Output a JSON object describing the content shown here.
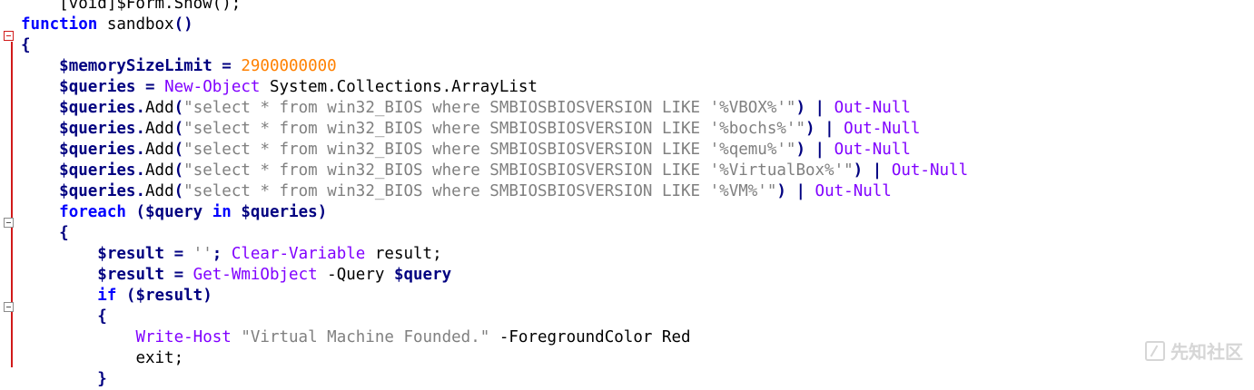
{
  "editor": {
    "lines": [
      [
        {
          "t": "    [void]$Form.Show();",
          "c": "txt"
        }
      ],
      [
        {
          "t": "function",
          "c": "kw"
        },
        {
          "t": " sandbox",
          "c": "txt"
        },
        {
          "t": "()",
          "c": "op"
        }
      ],
      [
        {
          "t": "{",
          "c": "op"
        }
      ],
      [
        {
          "t": "    ",
          "c": "txt"
        },
        {
          "t": "$memorySizeLimit",
          "c": "var"
        },
        {
          "t": " = ",
          "c": "op"
        },
        {
          "t": "2900000000",
          "c": "num"
        }
      ],
      [
        {
          "t": "    ",
          "c": "txt"
        },
        {
          "t": "$queries",
          "c": "var"
        },
        {
          "t": " = ",
          "c": "op"
        },
        {
          "t": "New-Object",
          "c": "cmd"
        },
        {
          "t": " System.Collections.ArrayList",
          "c": "txt"
        }
      ],
      [
        {
          "t": "    ",
          "c": "txt"
        },
        {
          "t": "$queries",
          "c": "var"
        },
        {
          "t": ".",
          "c": "op"
        },
        {
          "t": "Add",
          "c": "txt"
        },
        {
          "t": "(",
          "c": "op"
        },
        {
          "t": "\"select * from win32_BIOS where SMBIOSBIOSVERSION LIKE '%VBOX%'\"",
          "c": "str"
        },
        {
          "t": ") | ",
          "c": "op"
        },
        {
          "t": "Out-Null",
          "c": "cmd"
        }
      ],
      [
        {
          "t": "    ",
          "c": "txt"
        },
        {
          "t": "$queries",
          "c": "var"
        },
        {
          "t": ".",
          "c": "op"
        },
        {
          "t": "Add",
          "c": "txt"
        },
        {
          "t": "(",
          "c": "op"
        },
        {
          "t": "\"select * from win32_BIOS where SMBIOSBIOSVERSION LIKE '%bochs%'\"",
          "c": "str"
        },
        {
          "t": ") | ",
          "c": "op"
        },
        {
          "t": "Out-Null",
          "c": "cmd"
        }
      ],
      [
        {
          "t": "    ",
          "c": "txt"
        },
        {
          "t": "$queries",
          "c": "var"
        },
        {
          "t": ".",
          "c": "op"
        },
        {
          "t": "Add",
          "c": "txt"
        },
        {
          "t": "(",
          "c": "op"
        },
        {
          "t": "\"select * from win32_BIOS where SMBIOSBIOSVERSION LIKE '%qemu%'\"",
          "c": "str"
        },
        {
          "t": ") | ",
          "c": "op"
        },
        {
          "t": "Out-Null",
          "c": "cmd"
        }
      ],
      [
        {
          "t": "    ",
          "c": "txt"
        },
        {
          "t": "$queries",
          "c": "var"
        },
        {
          "t": ".",
          "c": "op"
        },
        {
          "t": "Add",
          "c": "txt"
        },
        {
          "t": "(",
          "c": "op"
        },
        {
          "t": "\"select * from win32_BIOS where SMBIOSBIOSVERSION LIKE '%VirtualBox%'\"",
          "c": "str"
        },
        {
          "t": ") | ",
          "c": "op"
        },
        {
          "t": "Out-Null",
          "c": "cmd"
        }
      ],
      [
        {
          "t": "    ",
          "c": "txt"
        },
        {
          "t": "$queries",
          "c": "var"
        },
        {
          "t": ".",
          "c": "op"
        },
        {
          "t": "Add",
          "c": "txt"
        },
        {
          "t": "(",
          "c": "op"
        },
        {
          "t": "\"select * from win32_BIOS where SMBIOSBIOSVERSION LIKE '%VM%'\"",
          "c": "str"
        },
        {
          "t": ") | ",
          "c": "op"
        },
        {
          "t": "Out-Null",
          "c": "cmd"
        }
      ],
      [
        {
          "t": "    ",
          "c": "txt"
        },
        {
          "t": "foreach",
          "c": "kw"
        },
        {
          "t": " (",
          "c": "op"
        },
        {
          "t": "$query",
          "c": "var"
        },
        {
          "t": " ",
          "c": "txt"
        },
        {
          "t": "in",
          "c": "kw"
        },
        {
          "t": " ",
          "c": "txt"
        },
        {
          "t": "$queries",
          "c": "var"
        },
        {
          "t": ")",
          "c": "op"
        }
      ],
      [
        {
          "t": "    ",
          "c": "txt"
        },
        {
          "t": "{",
          "c": "op"
        }
      ],
      [
        {
          "t": "        ",
          "c": "txt"
        },
        {
          "t": "$result",
          "c": "var"
        },
        {
          "t": " = ",
          "c": "op"
        },
        {
          "t": "''",
          "c": "str"
        },
        {
          "t": "; ",
          "c": "op"
        },
        {
          "t": "Clear-Variable",
          "c": "cmd"
        },
        {
          "t": " result;",
          "c": "txt"
        }
      ],
      [
        {
          "t": "        ",
          "c": "txt"
        },
        {
          "t": "$result",
          "c": "var"
        },
        {
          "t": " = ",
          "c": "op"
        },
        {
          "t": "Get-WmiObject",
          "c": "cmd"
        },
        {
          "t": " -Query ",
          "c": "txt"
        },
        {
          "t": "$query",
          "c": "var"
        }
      ],
      [
        {
          "t": "        ",
          "c": "txt"
        },
        {
          "t": "if",
          "c": "kw"
        },
        {
          "t": " (",
          "c": "op"
        },
        {
          "t": "$result",
          "c": "var"
        },
        {
          "t": ")",
          "c": "op"
        }
      ],
      [
        {
          "t": "        ",
          "c": "txt"
        },
        {
          "t": "{",
          "c": "op"
        }
      ],
      [
        {
          "t": "            ",
          "c": "txt"
        },
        {
          "t": "Write-Host",
          "c": "cmd"
        },
        {
          "t": " ",
          "c": "txt"
        },
        {
          "t": "\"Virtual Machine Founded.\"",
          "c": "str"
        },
        {
          "t": " -ForegroundColor Red",
          "c": "txt"
        }
      ],
      [
        {
          "t": "            ",
          "c": "txt"
        },
        {
          "t": "exit;",
          "c": "txt"
        }
      ],
      [
        {
          "t": "        ",
          "c": "txt"
        },
        {
          "t": "}",
          "c": "op"
        }
      ]
    ]
  },
  "watermark": {
    "text": "先知社区",
    "icon": "xianzhi-logo-icon"
  }
}
